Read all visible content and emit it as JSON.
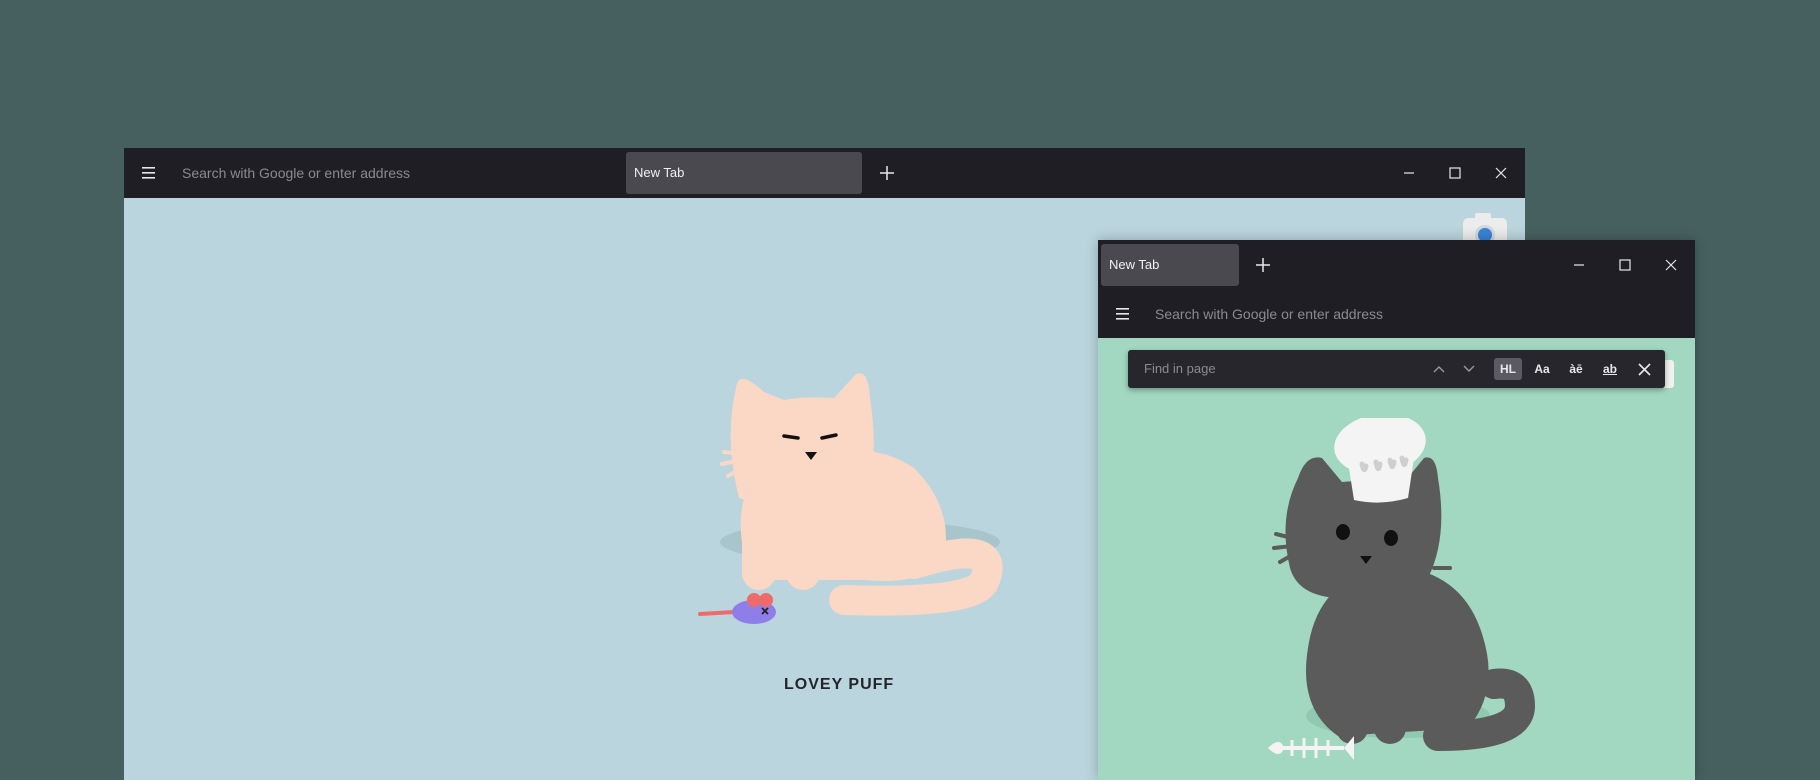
{
  "back_window": {
    "address_placeholder": "Search with Google or enter address",
    "tab_label": "New Tab",
    "page_caption": "LOVEY PUFF"
  },
  "front_window": {
    "tab_label": "New Tab",
    "address_placeholder": "Search with Google or enter address",
    "find_bar": {
      "placeholder": "Find in page",
      "highlight_label": "HL",
      "match_case_label": "Aa",
      "diacritics_label": "àē",
      "whole_words_label": "ab"
    }
  },
  "icons": {
    "menu": "hamburger-menu-icon",
    "new_tab": "plus-icon",
    "minimize": "minimize-icon",
    "maximize": "maximize-icon",
    "close": "close-icon",
    "find_prev": "chevron-up-icon",
    "find_next": "chevron-down-icon",
    "camera": "camera-icon"
  },
  "colors": {
    "desktop": "#466060",
    "titlebar": "#1f1e24",
    "back_page": "#bad5dd",
    "front_page": "#a2d8c1",
    "active_tab": "#4a4950"
  }
}
